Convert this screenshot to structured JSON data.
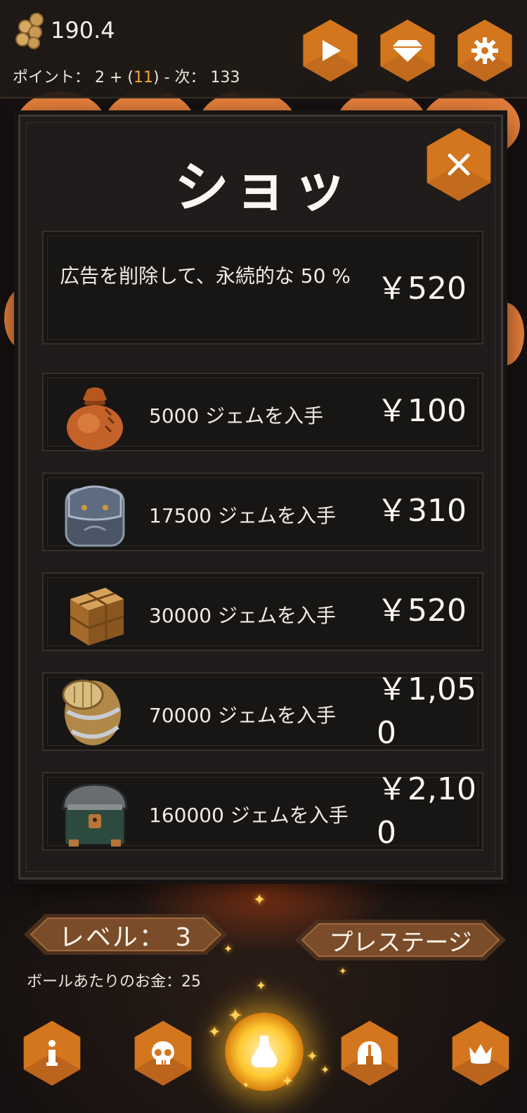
{
  "top_bar": {
    "coin_value": "190.4",
    "points_prefix": "ポイント： 2 + (",
    "points_highlight": "11",
    "points_suffix": ") - 次： 133",
    "buttons": [
      "play-icon",
      "diamond-icon",
      "gear-icon"
    ]
  },
  "shop": {
    "title": "ショッ",
    "close_icon": "close-icon",
    "items": [
      {
        "label": "広告を削除して、永続的な 50 %",
        "price": "￥520",
        "icon": "none"
      },
      {
        "label": "5000 ジェムを入手",
        "price": "￥100",
        "icon": "orange-sack-icon"
      },
      {
        "label": "17500 ジェムを入手",
        "price": "￥310",
        "icon": "blue-backpack-icon"
      },
      {
        "label": "30000 ジェムを入手",
        "price": "￥520",
        "icon": "wooden-crate-icon"
      },
      {
        "label": "70000 ジェムを入手",
        "price_line1": "￥1,05",
        "price_line2": "0",
        "icon": "barrel-icon"
      },
      {
        "label": "160000 ジェムを入手",
        "price_line1": "￥2,10",
        "price_line2": "0",
        "icon": "treasure-chest-icon"
      }
    ]
  },
  "bottom": {
    "level_label": "レベル： 3",
    "prestige_label": "プレステージ",
    "money_per_ball": "ボールあたりのお金：25",
    "nav": [
      "info-icon",
      "skull-icon",
      "potion-icon",
      "helmet-icon",
      "crown-icon"
    ]
  },
  "colors": {
    "accent": "#d3761e",
    "accent_dark": "#a8561a",
    "highlight": "#f0a63a",
    "panel": "#1f1c1b"
  }
}
